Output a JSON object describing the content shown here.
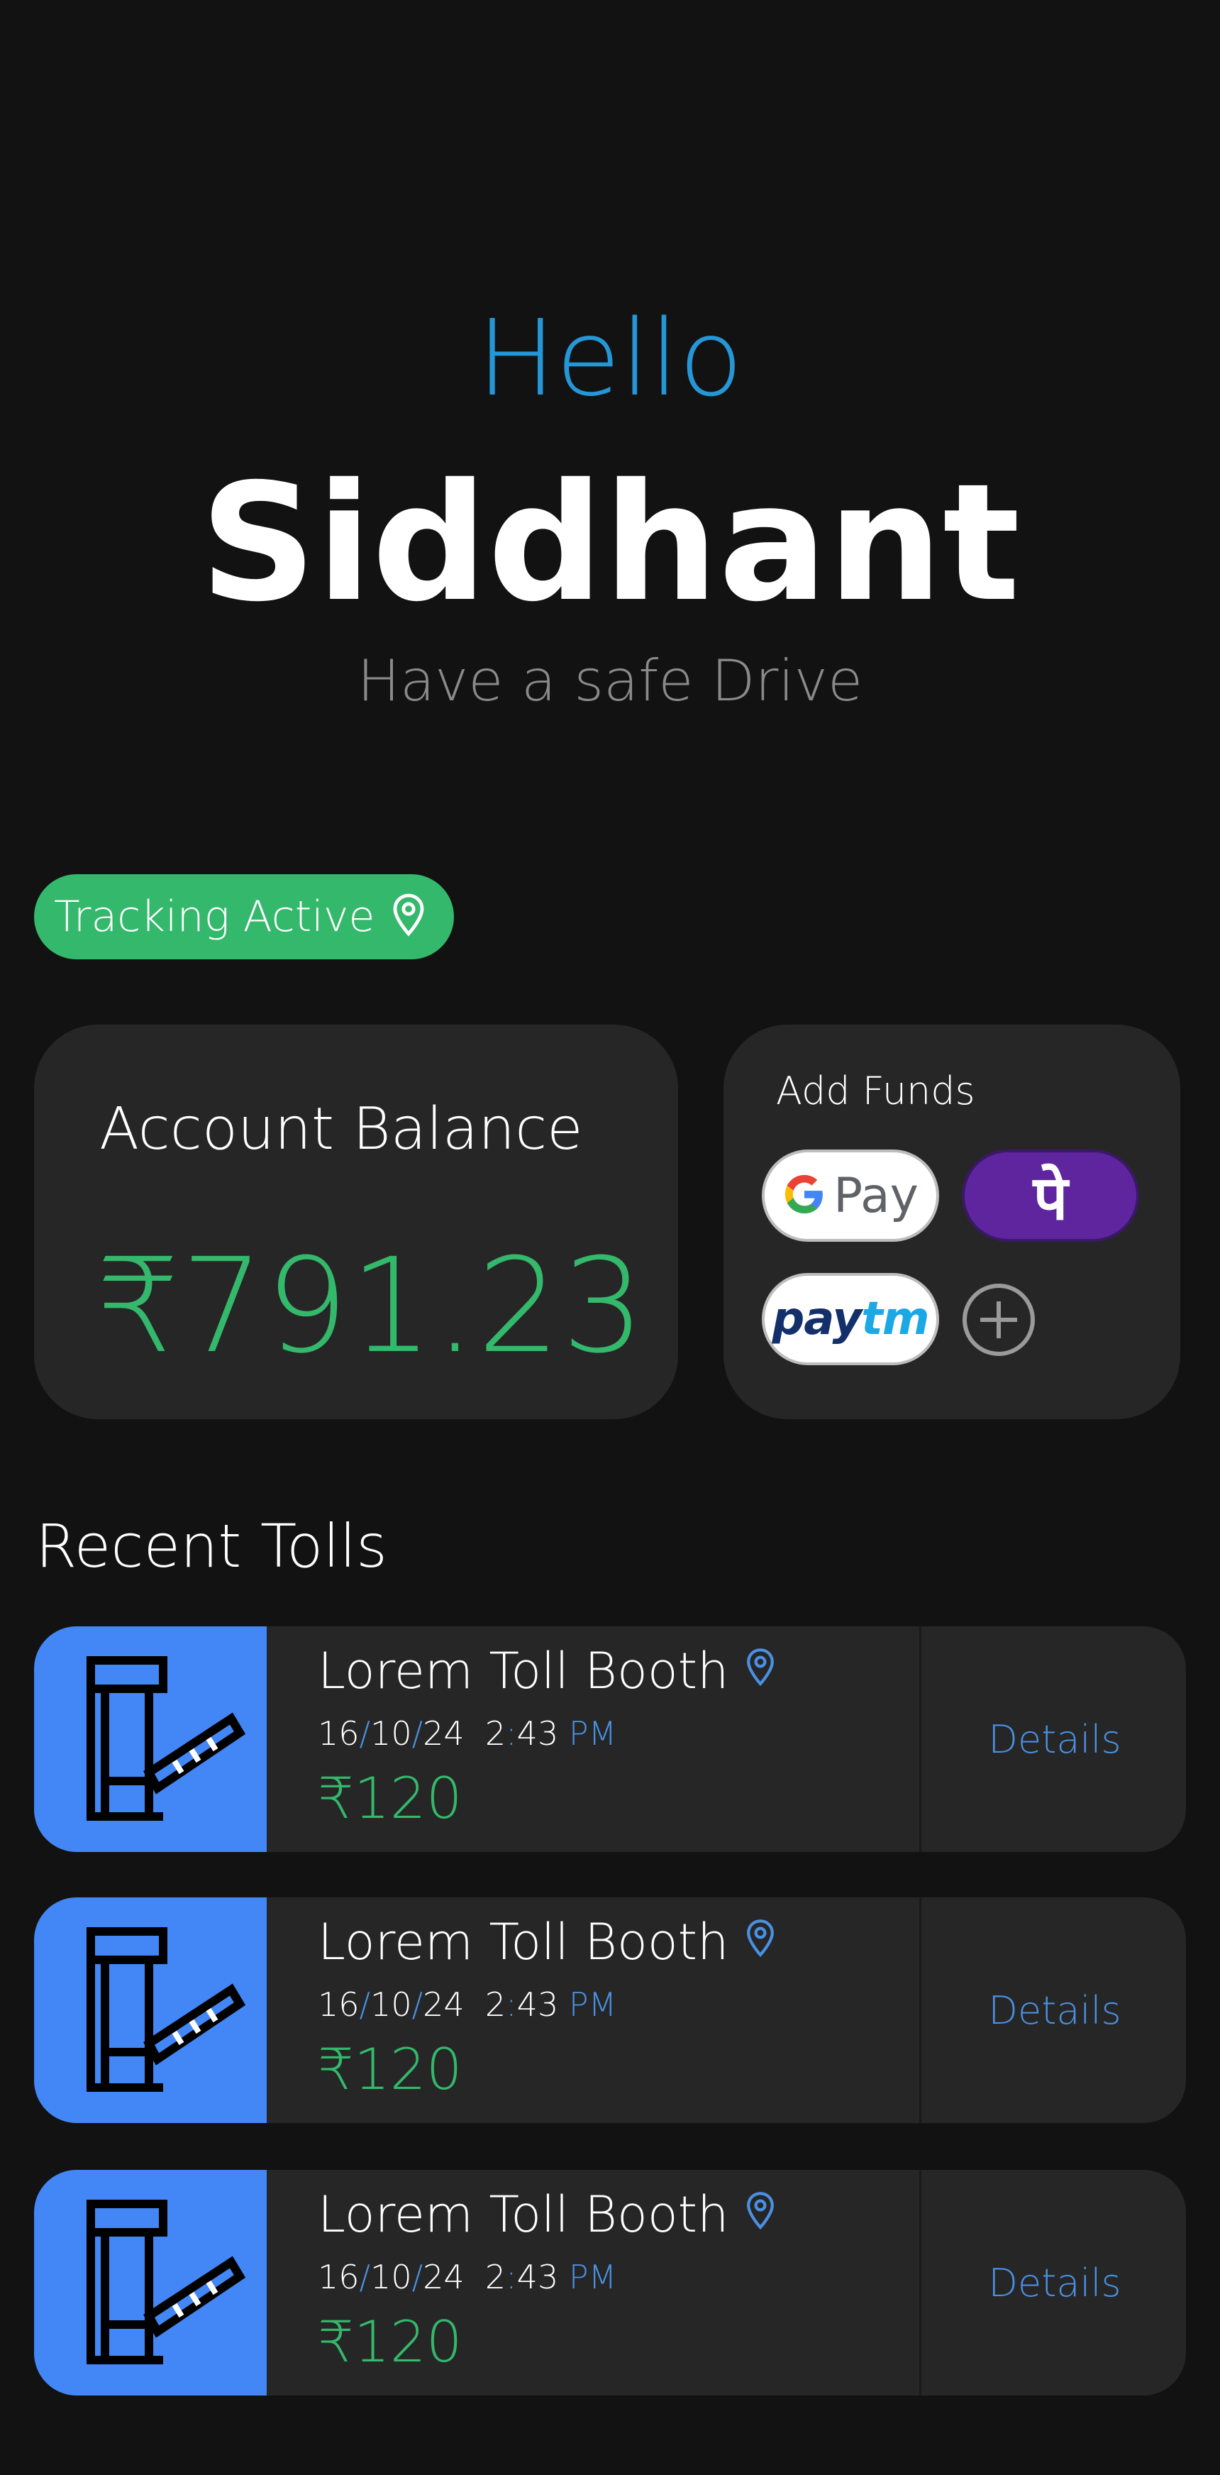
{
  "greeting": {
    "hello": "Hello",
    "name": "Siddhant",
    "tagline": "Have a safe Drive"
  },
  "tracking": {
    "label": "Tracking Active",
    "icon": "location-pin-icon"
  },
  "balance": {
    "title": "Account Balance",
    "amount": "₹791.23"
  },
  "funds": {
    "title": "Add Funds",
    "options": [
      {
        "name": "gpay",
        "label": "Pay"
      },
      {
        "name": "phonepe",
        "label": "पे"
      },
      {
        "name": "paytm",
        "label_a": "pay",
        "label_b": "tm"
      }
    ],
    "add_icon": "plus-circle-icon"
  },
  "recent": {
    "title": "Recent Tolls",
    "tolls": [
      {
        "name": "Lorem Toll Booth",
        "day": "16",
        "month": "10",
        "year": "24",
        "hour": "2",
        "minute": "43",
        "ampm": "PM",
        "amount": "₹120",
        "action": "Details"
      },
      {
        "name": "Lorem Toll Booth",
        "day": "16",
        "month": "10",
        "year": "24",
        "hour": "2",
        "minute": "43",
        "ampm": "PM",
        "amount": "₹120",
        "action": "Details"
      },
      {
        "name": "Lorem Toll Booth",
        "day": "16",
        "month": "10",
        "year": "24",
        "hour": "2",
        "minute": "43",
        "ampm": "PM",
        "amount": "₹120",
        "action": "Details"
      }
    ]
  },
  "colors": {
    "background": "#121212",
    "card": "#262626",
    "accent_blue": "#2596d6",
    "link_blue": "#4a90e2",
    "icon_bg_blue": "#4287f5",
    "green": "#34b86b",
    "phonepe_purple": "#5f259f"
  }
}
